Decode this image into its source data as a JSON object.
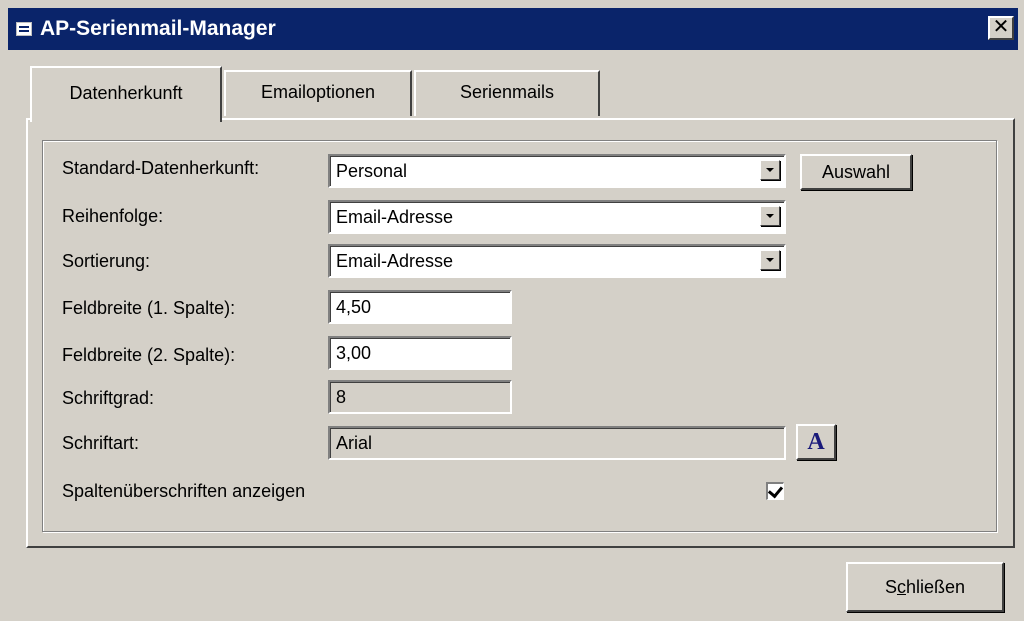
{
  "window": {
    "title": "AP-Serienmail-Manager",
    "close_glyph": "✕"
  },
  "tabs": [
    {
      "label": "Datenherkunft",
      "active": true
    },
    {
      "label": "Emailoptionen",
      "active": false
    },
    {
      "label": "Serienmails",
      "active": false
    }
  ],
  "form": {
    "standard_datenherkunft": {
      "label": "Standard-Datenherkunft:",
      "value": "Personal"
    },
    "auswahl_button": "Auswahl",
    "reihenfolge": {
      "label": "Reihenfolge:",
      "value": "Email-Adresse"
    },
    "sortierung": {
      "label": "Sortierung:",
      "value": "Email-Adresse"
    },
    "feldbreite1": {
      "label": "Feldbreite (1. Spalte):",
      "value": "4,50"
    },
    "feldbreite2": {
      "label": "Feldbreite (2. Spalte):",
      "value": "3,00"
    },
    "schriftgrad": {
      "label": "Schriftgrad:",
      "value": "8"
    },
    "schriftart": {
      "label": "Schriftart:",
      "value": "Arial"
    },
    "font_button_glyph": "A",
    "spaltenueberschriften": {
      "label": "Spaltenüberschriften anzeigen",
      "checked": true
    }
  },
  "footer": {
    "close_label_pre": "S",
    "close_label_mnemonic": "c",
    "close_label_post": "hließen"
  },
  "colors": {
    "titlebar": "#0a246a",
    "face": "#d4d0c8",
    "font_icon": "#1a1a7a"
  }
}
